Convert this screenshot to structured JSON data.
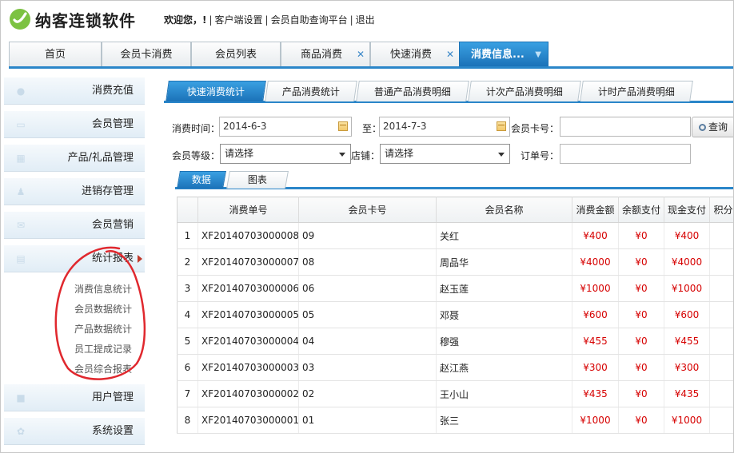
{
  "header": {
    "brand": "纳客连锁软件",
    "welcome": "欢迎您，!",
    "links": [
      "客户端设置",
      "会员自助查询平台",
      "退出"
    ]
  },
  "main_tabs": [
    {
      "label": "首页"
    },
    {
      "label": "会员卡消费"
    },
    {
      "label": "会员列表"
    },
    {
      "label": "商品消费"
    },
    {
      "label": "快速消费"
    },
    {
      "label": "消费信息..."
    }
  ],
  "sidebar": {
    "items": [
      {
        "label": "消费充值",
        "icon": "user-icon"
      },
      {
        "label": "会员管理",
        "icon": "card-icon"
      },
      {
        "label": "产品/礼品管理",
        "icon": "gift-icon"
      },
      {
        "label": "进销存管理",
        "icon": "people-icon"
      },
      {
        "label": "会员营销",
        "icon": "mail-icon"
      },
      {
        "label": "统计报表",
        "icon": "chart-icon"
      },
      {
        "label": "用户管理",
        "icon": "lock-icon"
      },
      {
        "label": "系统设置",
        "icon": "gear-icon"
      }
    ],
    "sub_items": [
      "消费信息统计",
      "会员数据统计",
      "产品数据统计",
      "员工提成记录",
      "会员综合报表"
    ]
  },
  "sub_tabs": [
    "快速消费统计",
    "产品消费统计",
    "普通产品消费明细",
    "计次产品消费明细",
    "计时产品消费明细"
  ],
  "filters": {
    "time_label": "消费时间：",
    "date_from": "2014-6-3",
    "to_label": "至：",
    "date_to": "2014-7-3",
    "card_label": "会员卡号：",
    "card_value": "",
    "query_button": "查询",
    "level_label": "会员等级：",
    "level_value": "请选择",
    "store_label": "店铺：",
    "store_value": "请选择",
    "order_label": "订单号：",
    "order_value": ""
  },
  "data_tabs": [
    "数据",
    "图表"
  ],
  "table": {
    "columns": [
      "",
      "消费单号",
      "会员卡号",
      "会员名称",
      "消费金额",
      "余额支付",
      "现金支付",
      "积分"
    ],
    "rows": [
      [
        "1",
        "XF20140703000008",
        "09",
        "关红",
        "¥400",
        "¥0",
        "¥400"
      ],
      [
        "2",
        "XF20140703000007",
        "08",
        "周品华",
        "¥4000",
        "¥0",
        "¥4000"
      ],
      [
        "3",
        "XF20140703000006",
        "06",
        "赵玉莲",
        "¥1000",
        "¥0",
        "¥1000"
      ],
      [
        "4",
        "XF20140703000005",
        "05",
        "邓聂",
        "¥600",
        "¥0",
        "¥600"
      ],
      [
        "5",
        "XF20140703000004",
        "04",
        "穆强",
        "¥455",
        "¥0",
        "¥455"
      ],
      [
        "6",
        "XF20140703000003",
        "03",
        "赵江燕",
        "¥300",
        "¥0",
        "¥300"
      ],
      [
        "7",
        "XF20140703000002",
        "02",
        "王小山",
        "¥435",
        "¥0",
        "¥435"
      ],
      [
        "8",
        "XF20140703000001",
        "01",
        "张三",
        "¥1000",
        "¥0",
        "¥1000"
      ]
    ]
  },
  "colors": {
    "accent": "#2a86c9",
    "money": "#d60000",
    "annotation": "#e0282e"
  }
}
